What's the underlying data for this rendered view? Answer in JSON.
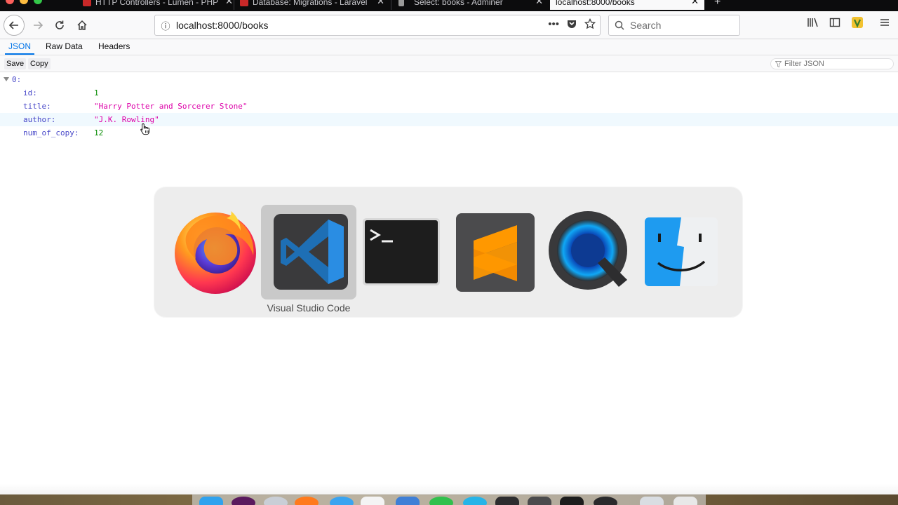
{
  "browser": {
    "tabs": [
      {
        "label": "HTTP Controllers - Lumen - PHP",
        "color": "#c82828"
      },
      {
        "label": "Database: Migrations - Laravel",
        "color": "#c82828"
      },
      {
        "label": "Select: books - Adminer",
        "color": "#7c7c7c"
      },
      {
        "label": "localhost:8000/books",
        "active": true
      }
    ],
    "new_tab_icon": "plus-icon",
    "url": "localhost:8000/books",
    "search_placeholder": "Search"
  },
  "viewer": {
    "tabs": [
      "JSON",
      "Raw Data",
      "Headers"
    ],
    "active_tab": "JSON",
    "save_label": "Save",
    "copy_label": "Copy",
    "filter_placeholder": "Filter JSON",
    "root_key": "0:",
    "fields": [
      {
        "key": "id:",
        "value": "1",
        "type": "number"
      },
      {
        "key": "title:",
        "value": "\"Harry Potter and Sorcerer Stone\"",
        "type": "string"
      },
      {
        "key": "author:",
        "value": "\"J.K. Rowling\"",
        "type": "string",
        "highlighted": true
      },
      {
        "key": "num_of_copy:",
        "value": "12",
        "type": "number"
      }
    ]
  },
  "app_switcher": {
    "apps": [
      "Firefox",
      "Visual Studio Code",
      "Terminal",
      "Sublime Text",
      "QuickTime Player",
      "Finder"
    ],
    "selected_label": "Visual Studio Code"
  },
  "colors": {
    "accent": "#0074e8",
    "json_key": "#4a4ac9",
    "json_number": "#058b00",
    "json_string": "#dd00a9"
  }
}
